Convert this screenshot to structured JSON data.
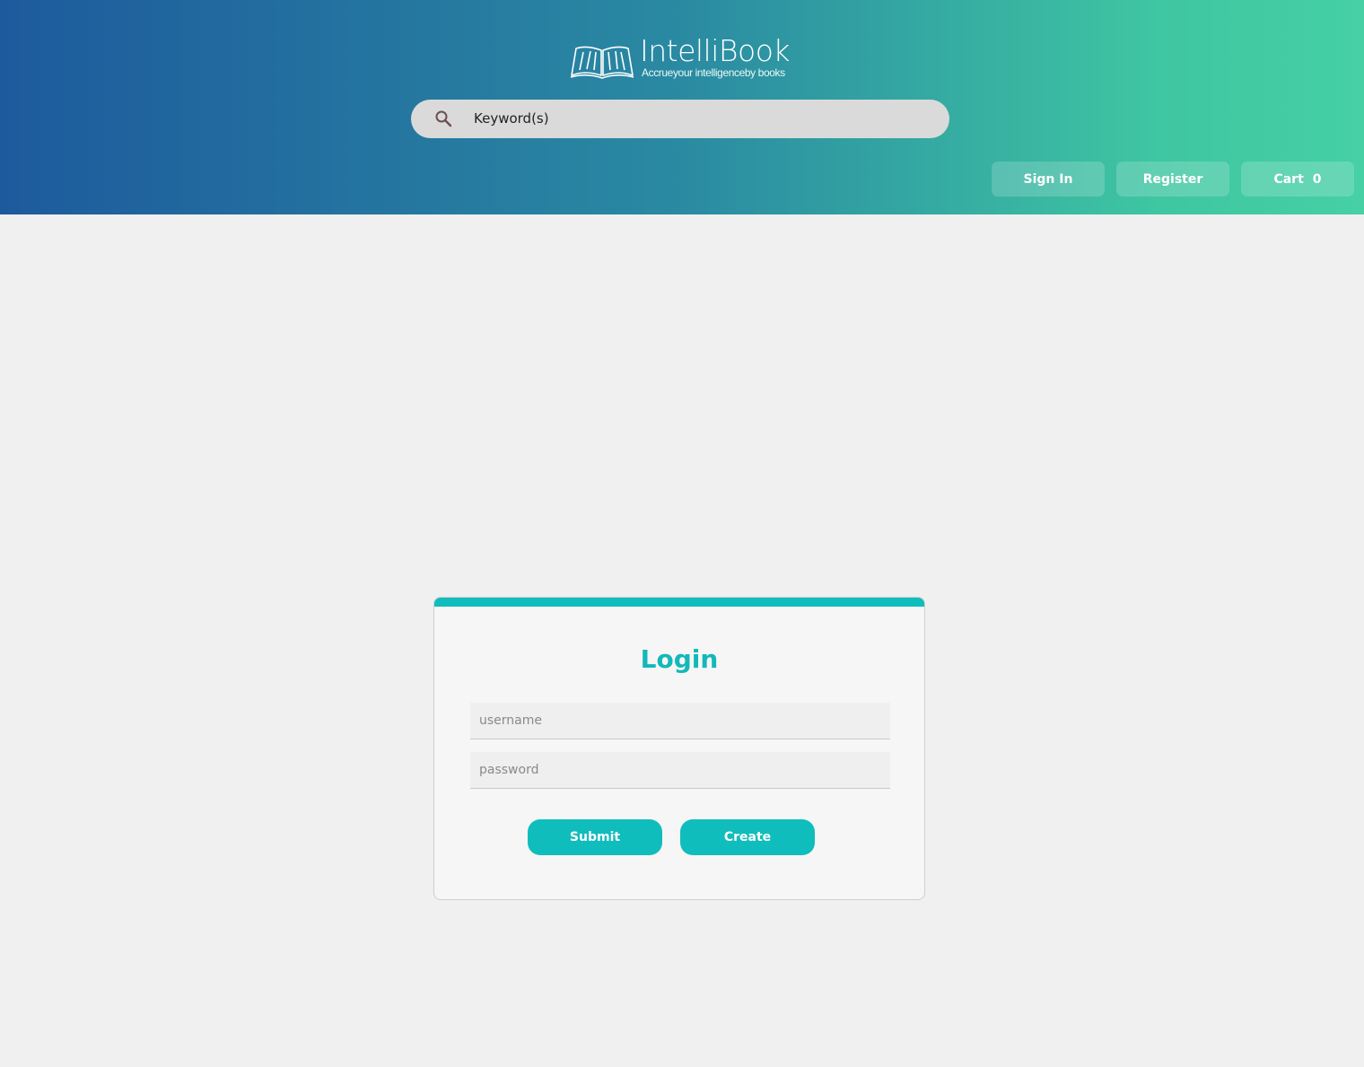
{
  "header": {
    "brand_name": "IntelliBook",
    "tagline": "Accrueyour intelligenceby books",
    "search_placeholder": "Keyword(s)",
    "nav": {
      "sign_in": "Sign In",
      "register": "Register",
      "cart_label": "Cart",
      "cart_count": "0"
    }
  },
  "login": {
    "title": "Login",
    "username_placeholder": "username",
    "password_placeholder": "password",
    "submit_label": "Submit",
    "create_label": "Create"
  },
  "colors": {
    "accent": "#10bdbd",
    "header_gradient_start": "#1d5a9d",
    "header_gradient_end": "#46d0a4"
  },
  "icons": {
    "search": "search-icon",
    "logo": "book-logo-icon"
  }
}
